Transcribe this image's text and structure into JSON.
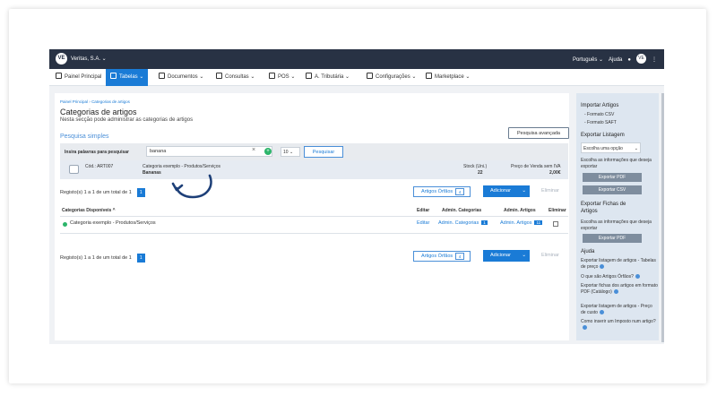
{
  "topbar": {
    "company": "Veritas, S.A. ⌄",
    "language": "Português ⌄",
    "help": "Ajuda"
  },
  "nav": [
    {
      "label": "Painel Principal",
      "active": false
    },
    {
      "label": "Tabelas ⌄",
      "active": true
    },
    {
      "label": "Documentos ⌄",
      "active": false
    },
    {
      "label": "Consultas ⌄",
      "active": false
    },
    {
      "label": "POS ⌄",
      "active": false
    },
    {
      "label": "A. Tributária ⌄",
      "active": false
    },
    {
      "label": "Configurações ⌄",
      "active": false
    },
    {
      "label": "Marketplace ⌄",
      "active": false
    }
  ],
  "page": {
    "breadcrumb_home": "Painel Principal",
    "breadcrumb_sep": "›",
    "breadcrumb_current": "Categorias de artigos",
    "title": "Categorias de artigos",
    "subtitle": "Nesta secção pode administrar as categorias de artigos",
    "section": "Pesquisa simples",
    "advanced_search": "Pesquisa avançada"
  },
  "search": {
    "label": "Insira palavras para pesquisar",
    "value": "banana",
    "clear": "×",
    "plus": "+",
    "page_size": "10 ⌄",
    "button": "Pesquisar"
  },
  "result": {
    "code": "Cód.: ART007",
    "category": "Categoria exemplo - Produtos/Serviços",
    "name": "Bananas",
    "stock_label": "Stock (Uni.)",
    "stock_value": "22",
    "price_label": "Preço de Venda sem IVA",
    "price_value": "2,00€"
  },
  "pagination": {
    "text": "Registo(s) 1 a 1 de um total de 1",
    "page": "1"
  },
  "actions": {
    "ortho_label": "Artigos Órfãos",
    "ortho_count": "4",
    "add_label": "Adicionar",
    "add_caret": "⌄",
    "delete_label": "Eliminar"
  },
  "table": {
    "headers": {
      "categories": "Categorias Disponíveis ^",
      "edit": "Editar",
      "admin_categories": "Admin. Categorias",
      "admin_articles": "Admin. Artigos",
      "delete": "Eliminar"
    },
    "row": {
      "name": "Categoria exemplo - Produtos/Serviços",
      "edit": "Editar",
      "admin_categories": "Admin. Categorias",
      "admin_categories_count": "1",
      "admin_articles": "Admin. Artigos",
      "admin_articles_count": "11"
    }
  },
  "sidebar": {
    "import_title": "Importar Artigos",
    "import_csv": "- Formato CSV",
    "import_saft": "- Formato SAFT",
    "export_title": "Exportar Listagem",
    "export_select": "Escolha uma opção",
    "export_hint": "Escolha as informações que deseja exportar",
    "export_pdf": "Exportar PDF",
    "export_csv": "Exportar CSV",
    "sheets_title": "Exportar Fichas de Artigos",
    "sheets_hint": "Escolha as informações que deseja exportar",
    "sheets_pdf": "Exportar PDF",
    "help_title": "Ajuda",
    "help_1": "Exportar listagem de artigos - Tabelas de preço",
    "help_2": "O que são Artigos Órfãos?",
    "help_3": "Exportar fichas dos artigos em formato PDF (Catálogo)",
    "help_4": "Exportar listagem de artigos - Preço de custo",
    "help_5": "Como inserir um Imposto num artigo?"
  },
  "colors": {
    "primary": "#1a7bd6",
    "topbar": "#283244",
    "sidebar": "#dde6f0"
  }
}
